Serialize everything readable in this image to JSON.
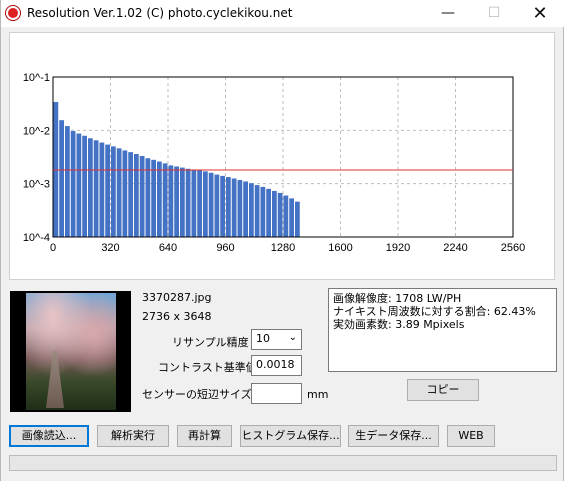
{
  "window": {
    "title": "Resolution Ver.1.02 (C) photo.cyclekikou.net",
    "minimize_glyph": "—",
    "maximize_glyph": "☐",
    "close_glyph": "✕",
    "app_icon": "camera-lens-icon"
  },
  "chart_data": {
    "type": "bar",
    "xlabel": "",
    "ylabel": "",
    "y_scale": "log",
    "xlim": [
      0,
      2560
    ],
    "ylim": [
      0.0001,
      0.1
    ],
    "x_ticks": [
      "0",
      "320",
      "640",
      "960",
      "1280",
      "1600",
      "1920",
      "2240",
      "2560"
    ],
    "y_ticks": [
      "10^-1",
      "10^-2",
      "10^-3",
      "10^-4"
    ],
    "grid": true,
    "bar_color": "#4472c4",
    "threshold_color": "#e03030",
    "threshold": 0.0018,
    "bin_width": 32,
    "x": [
      16,
      48,
      80,
      112,
      144,
      176,
      208,
      240,
      272,
      304,
      336,
      368,
      400,
      432,
      464,
      496,
      528,
      560,
      592,
      624,
      656,
      688,
      720,
      752,
      784,
      816,
      848,
      880,
      912,
      944,
      976,
      1008,
      1040,
      1072,
      1104,
      1136,
      1168,
      1200,
      1232,
      1264,
      1296,
      1328,
      1360
    ],
    "values": [
      0.034,
      0.0155,
      0.012,
      0.0097,
      0.0087,
      0.0079,
      0.0071,
      0.0065,
      0.0059,
      0.0054,
      0.005,
      0.0046,
      0.0042,
      0.0039,
      0.0036,
      0.0033,
      0.003,
      0.0028,
      0.0026,
      0.0024,
      0.0022,
      0.0021,
      0.002,
      0.0019,
      0.00185,
      0.0018,
      0.0017,
      0.0016,
      0.00148,
      0.0014,
      0.00133,
      0.00125,
      0.00117,
      0.0011,
      0.00102,
      0.00094,
      0.00087,
      0.0008,
      0.00073,
      0.00067,
      0.0006,
      0.00053,
      0.00046
    ]
  },
  "image": {
    "filename": "3370287.jpg",
    "dimensions": "2736 x 3648"
  },
  "settings": {
    "resample_label": "リサンプル精度",
    "resample_value": "10",
    "contrast_label": "コントラスト基準値",
    "contrast_value": "0.0018",
    "sensor_label": "センサーの短辺サイズ",
    "sensor_value": "",
    "sensor_unit": "mm"
  },
  "results": {
    "line1": "画像解像度: 1708 LW/PH",
    "line2": "ナイキスト周波数に対する割合: 62.43%",
    "line3": "実効画素数: 3.89 Mpixels"
  },
  "buttons": {
    "copy": "コピー",
    "load": "画像読込...",
    "analyze": "解析実行",
    "recalc": "再計算",
    "hist_save": "ヒストグラム保存...",
    "raw_save": "生データ保存...",
    "web": "WEB"
  },
  "progress": {
    "value": 0
  }
}
